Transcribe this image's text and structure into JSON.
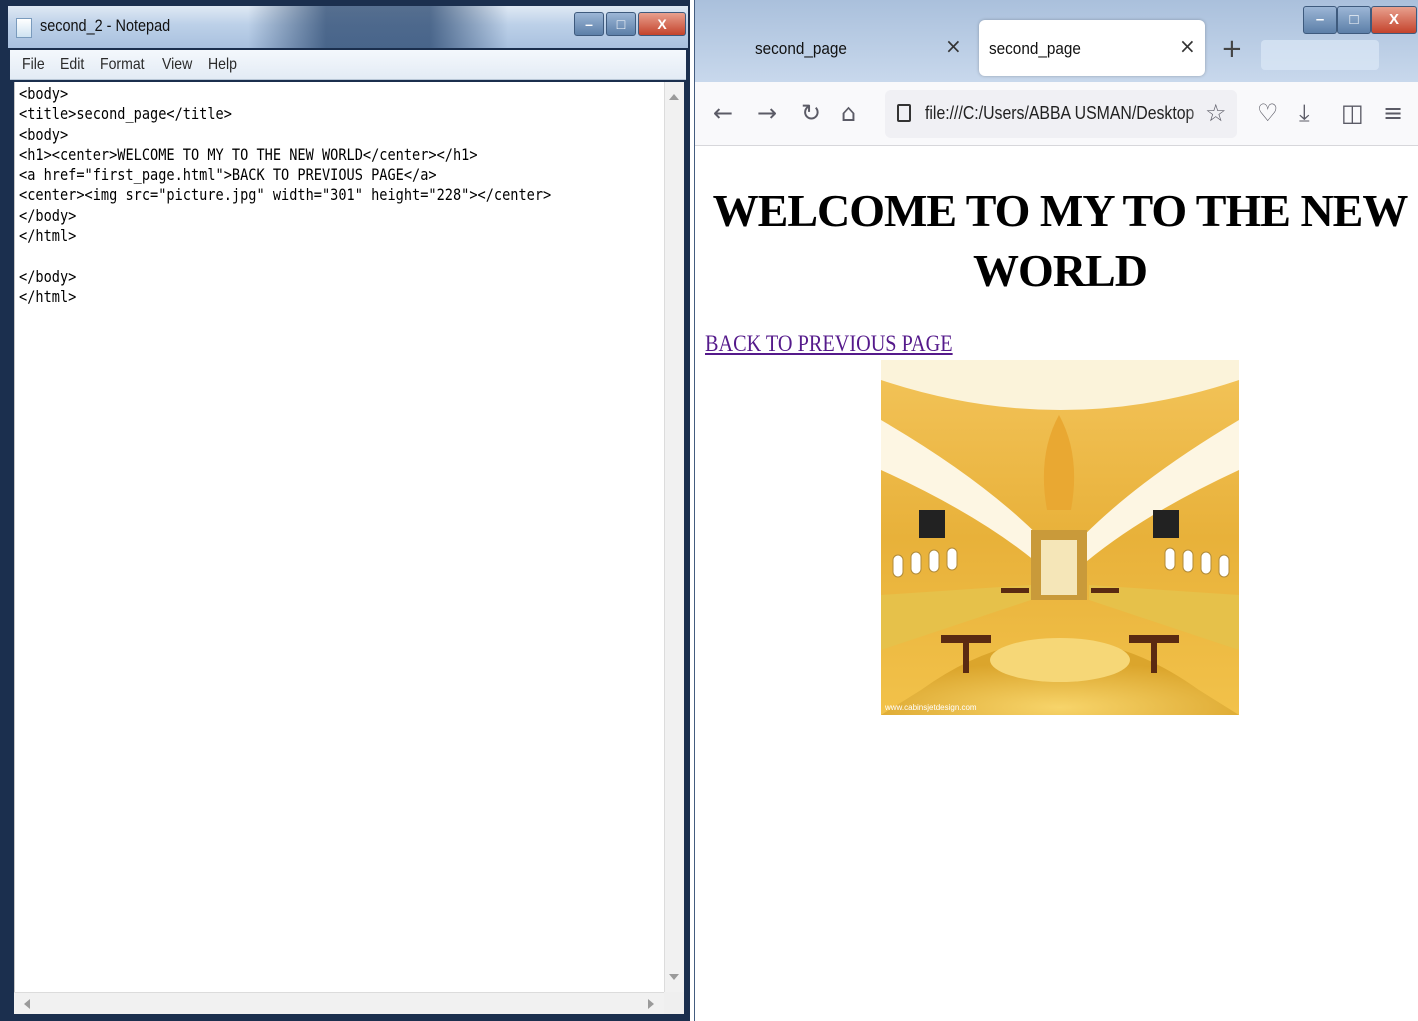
{
  "notepad": {
    "title": "second_2 - Notepad",
    "controls": {
      "minimize": "–",
      "maximize": "□",
      "close": "X"
    },
    "menu": [
      "File",
      "Edit",
      "Format",
      "View",
      "Help"
    ],
    "text": "<body>\n<title>second_page</title>\n<body>\n<h1><center>WELCOME TO MY TO THE NEW WORLD</center></h1>\n<a href=\"first_page.html\">BACK TO PREVIOUS PAGE</a>\n<center><img src=\"picture.jpg\" width=\"301\" height=\"228\"></center>\n</body>\n</html>\n\n</body>\n</html>"
  },
  "browser": {
    "tabs": [
      {
        "label": "second_page",
        "active": false
      },
      {
        "label": "second_page",
        "active": true
      }
    ],
    "tab_close_glyph": "×",
    "new_tab_glyph": "+",
    "controls": {
      "minimize": "–",
      "maximize": "□",
      "close": "X"
    },
    "toolbar": {
      "back": "←",
      "forward": "→",
      "reload": "↻",
      "home": "⌂",
      "url": "file:///C:/Users/ABBA USMAN/Desktop",
      "bookmark": "☆",
      "pocket": "♡",
      "downloads": "⤓",
      "sidebar": "◫",
      "menu": "≡"
    },
    "page": {
      "heading": "WELCOME TO MY TO THE NEW WORLD",
      "link": "BACK TO PREVIOUS PAGE",
      "image_watermark": "www.cabinsjetdesign.com"
    }
  },
  "colors": {
    "link_visited": "#551a8b",
    "titlebar": "#bcd0e8",
    "close_button": "#c4432c",
    "image_gold": "#e0b335"
  }
}
